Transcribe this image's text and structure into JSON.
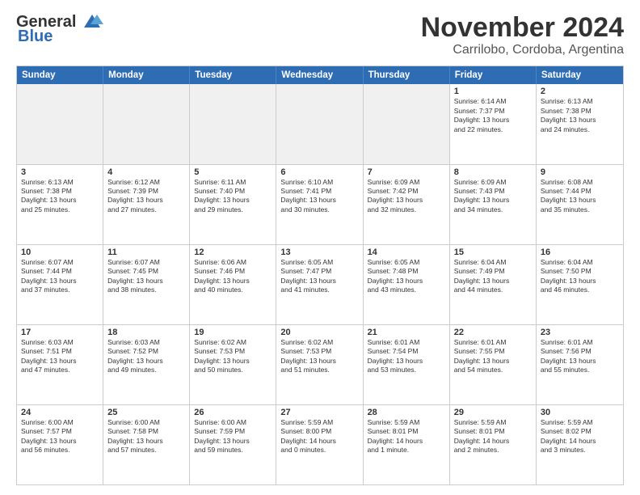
{
  "logo": {
    "line1": "General",
    "line2": "Blue"
  },
  "title": "November 2024",
  "subtitle": "Carrilobo, Cordoba, Argentina",
  "days": [
    "Sunday",
    "Monday",
    "Tuesday",
    "Wednesday",
    "Thursday",
    "Friday",
    "Saturday"
  ],
  "rows": [
    [
      {
        "day": "",
        "info": ""
      },
      {
        "day": "",
        "info": ""
      },
      {
        "day": "",
        "info": ""
      },
      {
        "day": "",
        "info": ""
      },
      {
        "day": "",
        "info": ""
      },
      {
        "day": "1",
        "info": "Sunrise: 6:14 AM\nSunset: 7:37 PM\nDaylight: 13 hours\nand 22 minutes."
      },
      {
        "day": "2",
        "info": "Sunrise: 6:13 AM\nSunset: 7:38 PM\nDaylight: 13 hours\nand 24 minutes."
      }
    ],
    [
      {
        "day": "3",
        "info": "Sunrise: 6:13 AM\nSunset: 7:38 PM\nDaylight: 13 hours\nand 25 minutes."
      },
      {
        "day": "4",
        "info": "Sunrise: 6:12 AM\nSunset: 7:39 PM\nDaylight: 13 hours\nand 27 minutes."
      },
      {
        "day": "5",
        "info": "Sunrise: 6:11 AM\nSunset: 7:40 PM\nDaylight: 13 hours\nand 29 minutes."
      },
      {
        "day": "6",
        "info": "Sunrise: 6:10 AM\nSunset: 7:41 PM\nDaylight: 13 hours\nand 30 minutes."
      },
      {
        "day": "7",
        "info": "Sunrise: 6:09 AM\nSunset: 7:42 PM\nDaylight: 13 hours\nand 32 minutes."
      },
      {
        "day": "8",
        "info": "Sunrise: 6:09 AM\nSunset: 7:43 PM\nDaylight: 13 hours\nand 34 minutes."
      },
      {
        "day": "9",
        "info": "Sunrise: 6:08 AM\nSunset: 7:44 PM\nDaylight: 13 hours\nand 35 minutes."
      }
    ],
    [
      {
        "day": "10",
        "info": "Sunrise: 6:07 AM\nSunset: 7:44 PM\nDaylight: 13 hours\nand 37 minutes."
      },
      {
        "day": "11",
        "info": "Sunrise: 6:07 AM\nSunset: 7:45 PM\nDaylight: 13 hours\nand 38 minutes."
      },
      {
        "day": "12",
        "info": "Sunrise: 6:06 AM\nSunset: 7:46 PM\nDaylight: 13 hours\nand 40 minutes."
      },
      {
        "day": "13",
        "info": "Sunrise: 6:05 AM\nSunset: 7:47 PM\nDaylight: 13 hours\nand 41 minutes."
      },
      {
        "day": "14",
        "info": "Sunrise: 6:05 AM\nSunset: 7:48 PM\nDaylight: 13 hours\nand 43 minutes."
      },
      {
        "day": "15",
        "info": "Sunrise: 6:04 AM\nSunset: 7:49 PM\nDaylight: 13 hours\nand 44 minutes."
      },
      {
        "day": "16",
        "info": "Sunrise: 6:04 AM\nSunset: 7:50 PM\nDaylight: 13 hours\nand 46 minutes."
      }
    ],
    [
      {
        "day": "17",
        "info": "Sunrise: 6:03 AM\nSunset: 7:51 PM\nDaylight: 13 hours\nand 47 minutes."
      },
      {
        "day": "18",
        "info": "Sunrise: 6:03 AM\nSunset: 7:52 PM\nDaylight: 13 hours\nand 49 minutes."
      },
      {
        "day": "19",
        "info": "Sunrise: 6:02 AM\nSunset: 7:53 PM\nDaylight: 13 hours\nand 50 minutes."
      },
      {
        "day": "20",
        "info": "Sunrise: 6:02 AM\nSunset: 7:53 PM\nDaylight: 13 hours\nand 51 minutes."
      },
      {
        "day": "21",
        "info": "Sunrise: 6:01 AM\nSunset: 7:54 PM\nDaylight: 13 hours\nand 53 minutes."
      },
      {
        "day": "22",
        "info": "Sunrise: 6:01 AM\nSunset: 7:55 PM\nDaylight: 13 hours\nand 54 minutes."
      },
      {
        "day": "23",
        "info": "Sunrise: 6:01 AM\nSunset: 7:56 PM\nDaylight: 13 hours\nand 55 minutes."
      }
    ],
    [
      {
        "day": "24",
        "info": "Sunrise: 6:00 AM\nSunset: 7:57 PM\nDaylight: 13 hours\nand 56 minutes."
      },
      {
        "day": "25",
        "info": "Sunrise: 6:00 AM\nSunset: 7:58 PM\nDaylight: 13 hours\nand 57 minutes."
      },
      {
        "day": "26",
        "info": "Sunrise: 6:00 AM\nSunset: 7:59 PM\nDaylight: 13 hours\nand 59 minutes."
      },
      {
        "day": "27",
        "info": "Sunrise: 5:59 AM\nSunset: 8:00 PM\nDaylight: 14 hours\nand 0 minutes."
      },
      {
        "day": "28",
        "info": "Sunrise: 5:59 AM\nSunset: 8:01 PM\nDaylight: 14 hours\nand 1 minute."
      },
      {
        "day": "29",
        "info": "Sunrise: 5:59 AM\nSunset: 8:01 PM\nDaylight: 14 hours\nand 2 minutes."
      },
      {
        "day": "30",
        "info": "Sunrise: 5:59 AM\nSunset: 8:02 PM\nDaylight: 14 hours\nand 3 minutes."
      }
    ]
  ]
}
